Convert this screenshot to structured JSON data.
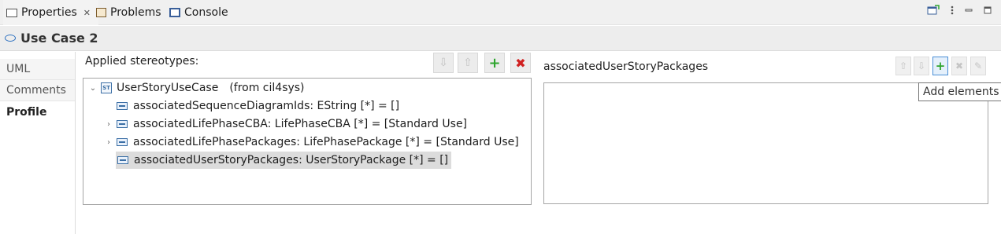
{
  "tabs": [
    {
      "label": "Properties",
      "close": "✕"
    },
    {
      "label": "Problems"
    },
    {
      "label": "Console"
    }
  ],
  "title": "Use Case 2",
  "side_tabs": [
    "UML",
    "Comments",
    "Profile"
  ],
  "applied": {
    "label": "Applied stereotypes:",
    "stereotype": "UserStoryUseCase",
    "stereotype_from": "(from cil4sys)",
    "properties": [
      "associatedSequenceDiagramIds: EString [*] = []",
      "associatedLifePhaseCBA: LifePhaseCBA [*] = [Standard Use]",
      "associatedLifePhasePackages: LifePhasePackage [*] = [Standard Use]",
      "associatedUserStoryPackages: UserStoryPackage [*] = []"
    ]
  },
  "right": {
    "label": "associatedUserStoryPackages",
    "tooltip": "Add elements"
  },
  "icons": {
    "move_down": "arrow-down-icon",
    "move_up": "arrow-up-icon",
    "add": "plus-icon",
    "delete": "x-icon",
    "edit": "pencil-icon"
  },
  "colors": {
    "add_green": "#2fa52f",
    "delete_red": "#d02020",
    "selection": "#dcdcdc",
    "accent_blue": "#2a6fbf"
  }
}
